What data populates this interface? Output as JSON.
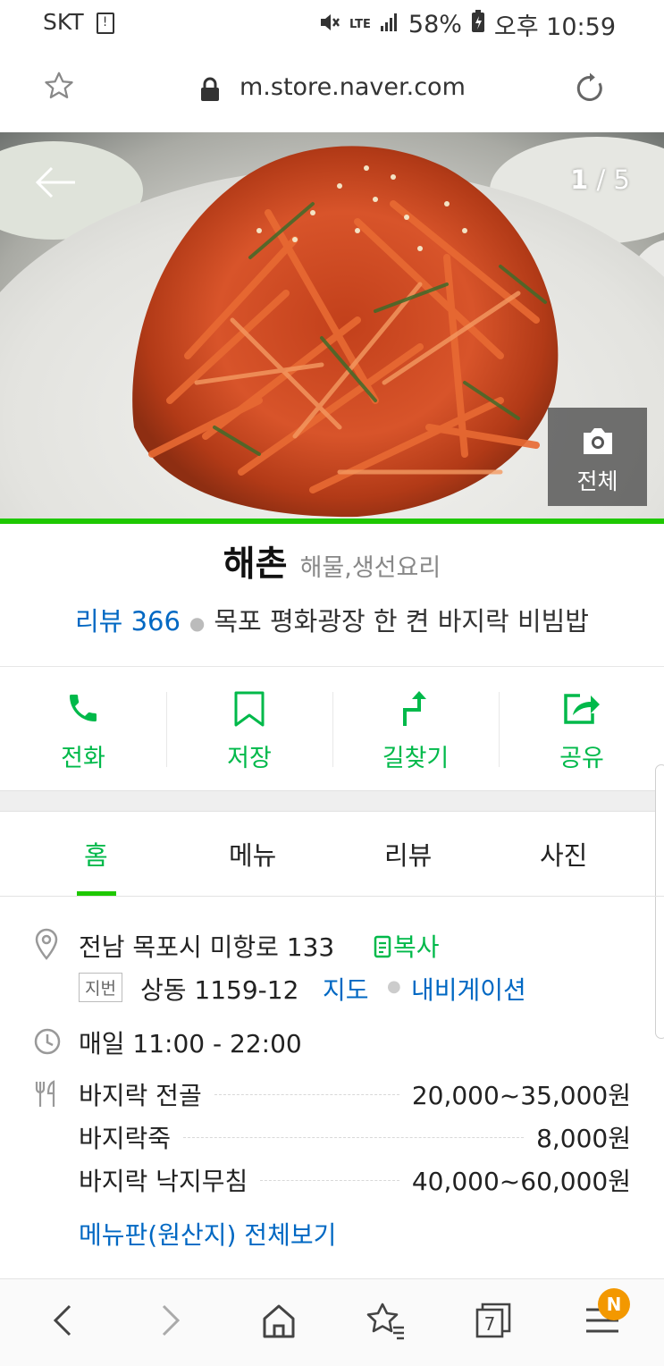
{
  "status_bar": {
    "carrier": "SKT",
    "network": "LTE",
    "battery": "58%",
    "time": "오후 10:59"
  },
  "browser": {
    "url": "m.store.naver.com"
  },
  "hero": {
    "counter_current": "1",
    "counter_sep": " / ",
    "counter_total": "5",
    "photo_all_label": "전체"
  },
  "store": {
    "name": "해촌",
    "category": "해물,생선요리",
    "review_label": "리뷰 366",
    "description": "목포 평화광장 한 켠 바지락 비빔밥"
  },
  "actions": [
    {
      "label": "전화",
      "icon": "phone-icon"
    },
    {
      "label": "저장",
      "icon": "bookmark-icon"
    },
    {
      "label": "길찾기",
      "icon": "directions-icon"
    },
    {
      "label": "공유",
      "icon": "share-icon"
    }
  ],
  "tabs": [
    {
      "label": "홈",
      "active": true
    },
    {
      "label": "메뉴",
      "active": false
    },
    {
      "label": "리뷰",
      "active": false
    },
    {
      "label": "사진",
      "active": false
    }
  ],
  "info": {
    "address": "전남 목포시 미항로 133",
    "copy_label": "복사",
    "lot_tag": "지번",
    "lot_address": "상동 1159-12",
    "map_link": "지도",
    "navigation_link": "내비게이션",
    "hours": "매일 11:00 - 22:00",
    "menu": [
      {
        "name": "바지락 전골",
        "price": "20,000~35,000원"
      },
      {
        "name": "바지락죽",
        "price": "8,000원"
      },
      {
        "name": "바지락 낙지무침",
        "price": "40,000~60,000원"
      }
    ],
    "menu_all_link": "메뉴판(원산지) 전체보기"
  },
  "bottom_nav": {
    "tabs_count": "7",
    "badge": "N"
  },
  "colors": {
    "naver_green": "#1ec800",
    "label_green": "#00b94a",
    "link_blue": "#0068c3",
    "badge_orange": "#f39800"
  }
}
